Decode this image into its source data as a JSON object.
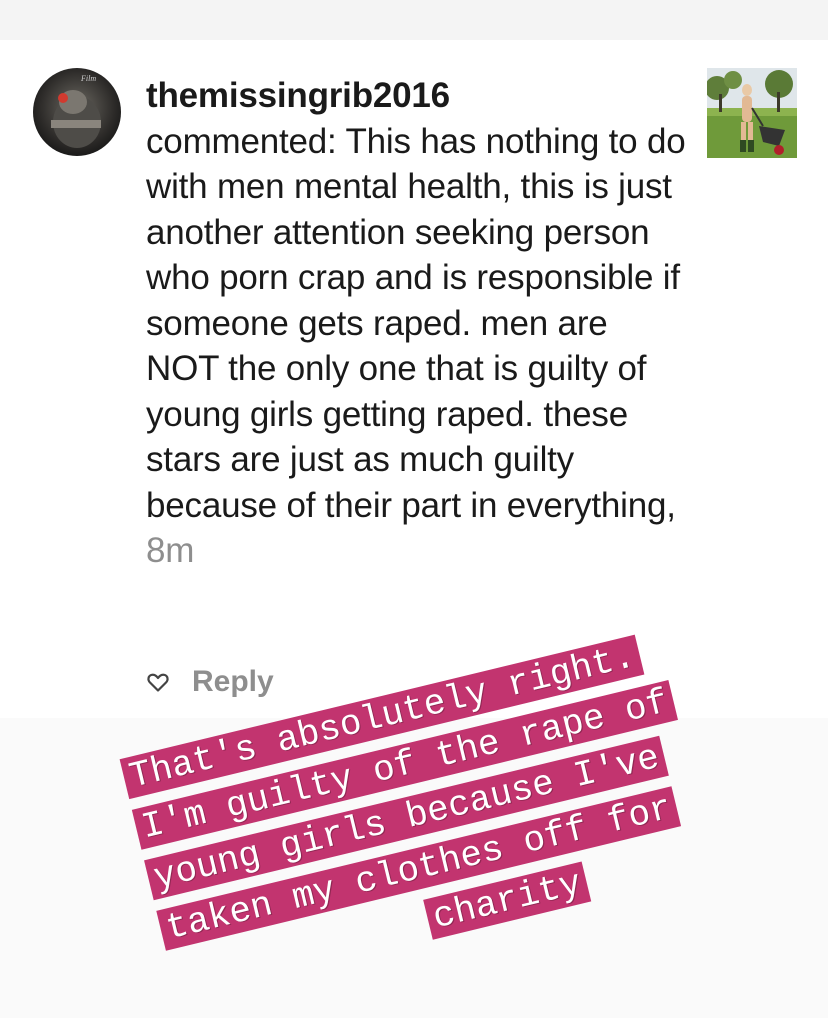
{
  "comment": {
    "username": "themissingrib2016",
    "text": "commented: This has nothing to do with men mental health, this is just another attention seeking person who porn crap and is responsible if someone gets raped. men are NOT the only one that is guilty of young girls getting raped. these stars are just as much guilty because of their part in everything,",
    "time": "8m",
    "reply_label": "Reply",
    "icons": {
      "like": "heart-outline-icon"
    }
  },
  "overlay": {
    "lines": [
      "That's absolutely right.",
      "I'm guilty of the rape of",
      "young girls because I've",
      "taken my clothes off for",
      "charity"
    ],
    "color": "#c2346f"
  }
}
